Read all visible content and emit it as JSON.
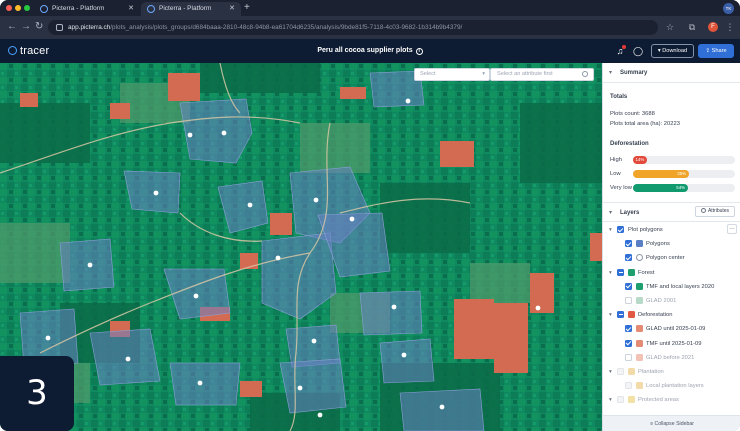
{
  "browser": {
    "tabs": [
      {
        "title": "Picterra - Platform",
        "active": false
      },
      {
        "title": "Picterra - Platform",
        "active": true
      }
    ],
    "url_host": "app.picterra.ch",
    "url_path": "/plots_analysis/plots_groups/d684baaa-2810-48c8-94b8-ea61704d6235/analysis/9bde81f5-7118-4c03-9682-1b314b9b4379/",
    "account_initials": "TK",
    "ext_letter": "F"
  },
  "app": {
    "logo_text": "tracer",
    "page_title": "Peru all cocoa supplier plots",
    "download_label": "Download",
    "share_label": "Share"
  },
  "map": {
    "select_placeholder": "Select",
    "attribute_placeholder": "Select an attribute first",
    "step_number": "3"
  },
  "sidebar": {
    "summary_title": "Summary",
    "totals_title": "Totals",
    "plots_count": "Plots count: 3688",
    "plots_area": "Plots total area (ha): 20223",
    "deforestation_title": "Deforestation",
    "deforestation_levels": [
      {
        "label": "High",
        "value": "14%",
        "fraction": 0.14,
        "color": "#e24b3b"
      },
      {
        "label": "Low",
        "value": "35%",
        "fraction": 0.55,
        "color": "#f0a429"
      },
      {
        "label": "Very low",
        "value": "54%",
        "fraction": 0.54,
        "color": "#119a6e"
      }
    ],
    "layers_title": "Layers",
    "attributes_label": "Attributes",
    "layers": [
      {
        "label": "Plot polygons",
        "state": "on",
        "swatch": "",
        "group": true
      },
      {
        "label": "Polygons",
        "state": "on",
        "swatch": "#5a7fc4",
        "group": false
      },
      {
        "label": "Polygon center",
        "state": "on",
        "swatch": "circle",
        "group": false
      },
      {
        "label": "Forest",
        "state": "part",
        "swatch": "#1f9e6e",
        "group": true
      },
      {
        "label": "TMF and local layers 2020",
        "state": "on",
        "swatch": "#1f9e6e",
        "group": false
      },
      {
        "label": "GLAD 2001",
        "state": "off",
        "swatch": "#b7d9c7",
        "group": false
      },
      {
        "label": "Deforestation",
        "state": "part",
        "swatch": "#e05a43",
        "group": true
      },
      {
        "label": "GLAD until 2025-01-09",
        "state": "on",
        "swatch": "#e58a74",
        "group": false
      },
      {
        "label": "TMF until 2025-01-09",
        "state": "on",
        "swatch": "#e58a74",
        "group": false
      },
      {
        "label": "GLAD before 2021",
        "state": "off",
        "swatch": "#f1c2b5",
        "group": false
      },
      {
        "label": "Plantation",
        "state": "faded",
        "swatch": "#f2dba8",
        "group": true
      },
      {
        "label": "Local plantation layers",
        "state": "faded",
        "swatch": "#f2dba8",
        "group": false
      },
      {
        "label": "Protected areas",
        "state": "faded",
        "swatch": "#f3e2a6",
        "group": true
      }
    ],
    "collapse_label": "Collapse Sidebar"
  }
}
